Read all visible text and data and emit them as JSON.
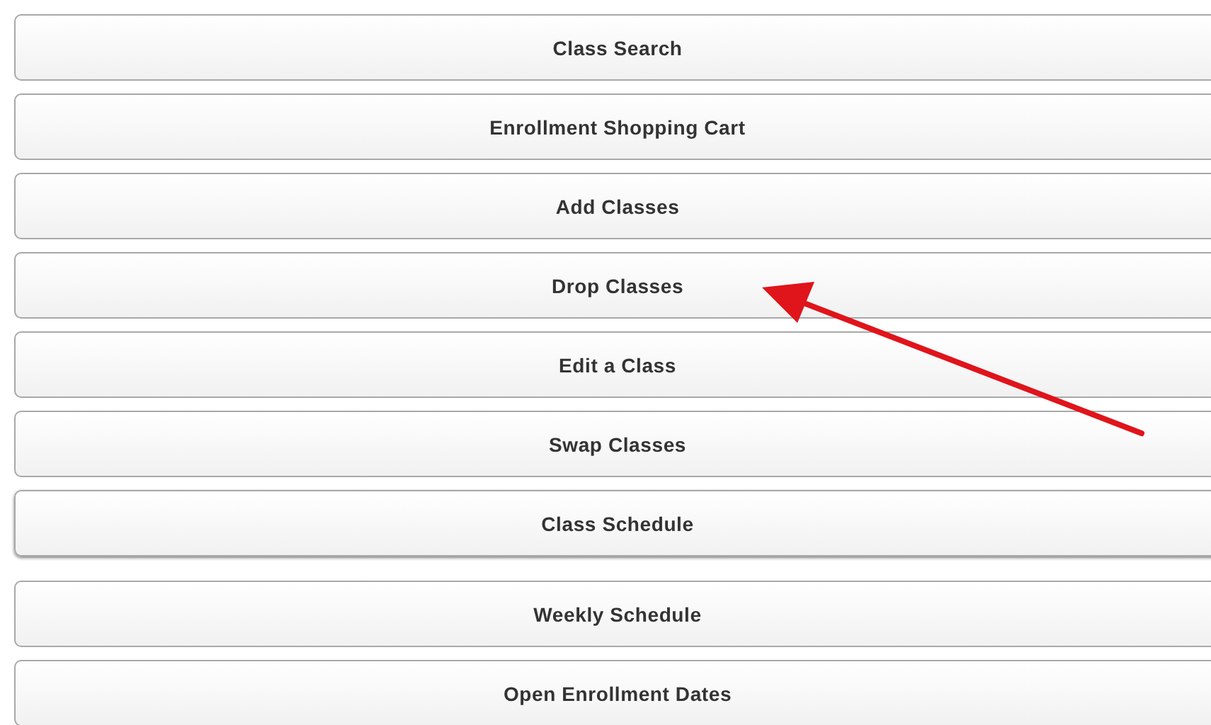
{
  "menu": [
    {
      "label": "Class Search"
    },
    {
      "label": "Enrollment Shopping Cart"
    },
    {
      "label": "Add Classes"
    },
    {
      "label": "Drop Classes"
    },
    {
      "label": "Edit a Class"
    },
    {
      "label": "Swap Classes"
    },
    {
      "label": "Class Schedule"
    },
    {
      "label": "Weekly Schedule"
    },
    {
      "label": "Open Enrollment Dates"
    }
  ]
}
